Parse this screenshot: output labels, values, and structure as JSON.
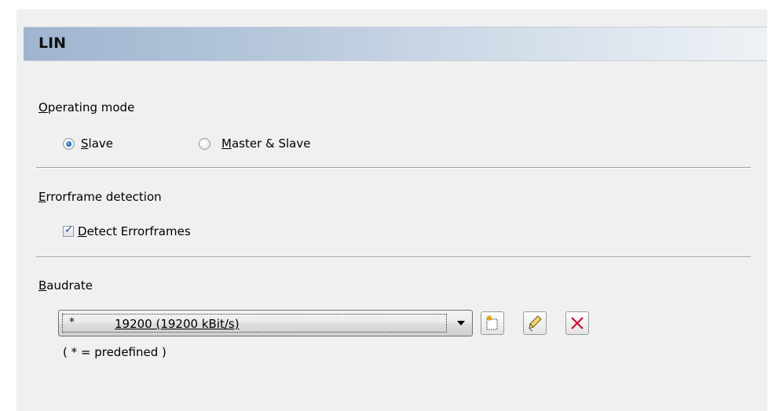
{
  "header": {
    "title": "LIN"
  },
  "operating_mode": {
    "label": "Operating mode",
    "options": [
      {
        "label": "Slave",
        "selected": true
      },
      {
        "label": "Master & Slave",
        "selected": false
      }
    ]
  },
  "errorframe": {
    "label": "Errorframe detection",
    "checkbox_label": "Detect Errorframes",
    "checked": true
  },
  "baudrate": {
    "label": "Baudrate",
    "selected_marker": "*",
    "selected_value": "19200 (19200 kBit/s)",
    "legend": "( * = predefined )",
    "buttons": [
      {
        "icon": "new-icon"
      },
      {
        "icon": "edit-pencil-icon"
      },
      {
        "icon": "delete-x-icon"
      }
    ]
  },
  "colors": {
    "header_gradient_start": "#9fb4cf",
    "panel_bg": "#f0f0f0",
    "delete_red": "#c8102e"
  }
}
